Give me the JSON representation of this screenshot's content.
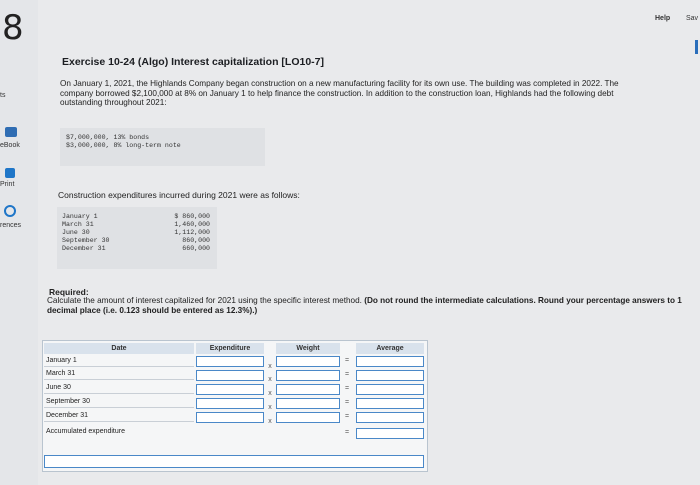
{
  "question_number": "8",
  "sidebar": {
    "partial_top": "ts",
    "book": "eBook",
    "print": "Print",
    "references": "rences"
  },
  "topbar": {
    "help": "Help",
    "save": "Sav"
  },
  "exercise": {
    "title": "Exercise 10-24 (Algo) Interest capitalization [LO10-7]",
    "intro": "On January 1, 2021, the Highlands Company began construction on a new manufacturing facility for its own use. The building was completed in 2022. The company borrowed $2,100,000 at 8% on January 1 to help finance the construction. In addition to the construction loan, Highlands had the following debt outstanding throughout 2021:",
    "debts": [
      "$7,000,000, 13% bonds",
      "$3,000,000, 8% long-term note"
    ],
    "expenditures_heading": "Construction expenditures incurred during 2021 were as follows:",
    "expenditures": {
      "dates": [
        "January 1",
        "March 31",
        "June 30",
        "September 30",
        "December 31"
      ],
      "amounts": [
        "$ 860,000",
        "1,460,000",
        "1,112,000",
        "860,000",
        "660,000"
      ]
    },
    "required_label": "Required:",
    "required_text": "Calculate the amount of interest capitalized for 2021 using the specific interest method.",
    "required_bold": "(Do not round the intermediate calculations. Round your percentage answers to 1 decimal place (i.e. 0.123 should be entered as 12.3%).)"
  },
  "table": {
    "headers": {
      "date": "Date",
      "expenditure": "Expenditure",
      "weight": "Weight",
      "average": "Average"
    },
    "rows": [
      "January 1",
      "March 31",
      "June 30",
      "September 30",
      "December 31",
      "Accumulated expenditure"
    ],
    "multiply_symbol": "x",
    "equals_symbol": "="
  }
}
